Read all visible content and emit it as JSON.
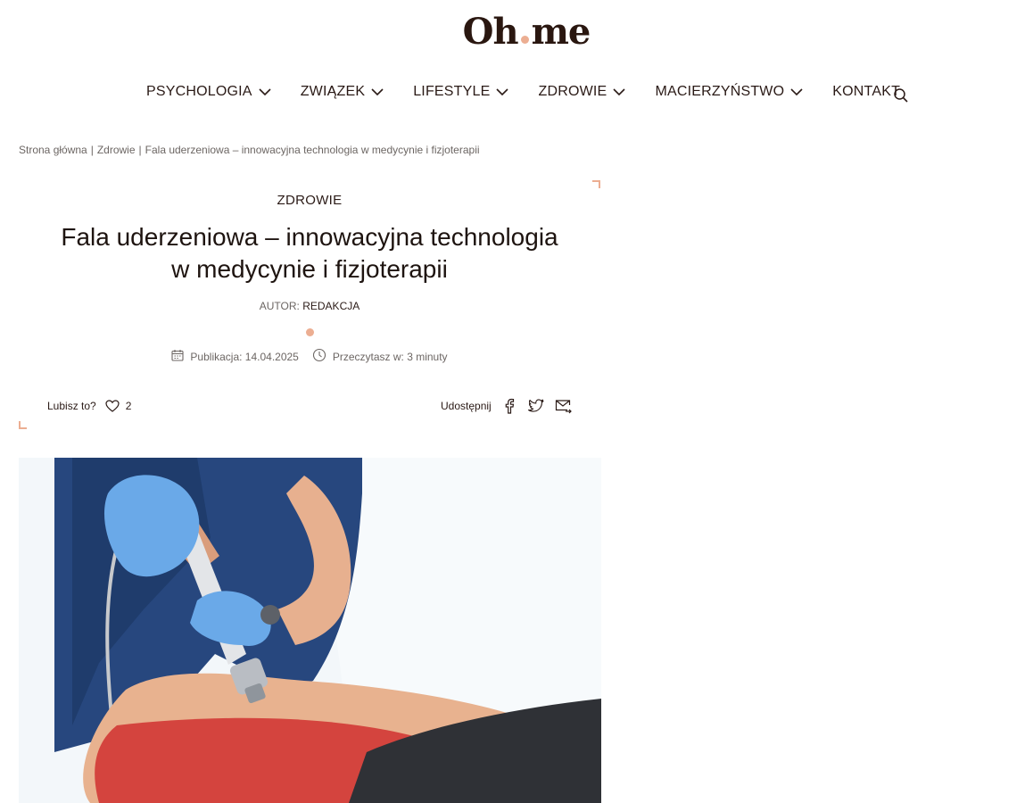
{
  "logo": {
    "part1": "Oh",
    "part2": "me"
  },
  "nav": [
    {
      "label": "PSYCHOLOGIA",
      "dropdown": true
    },
    {
      "label": "ZWIĄZEK",
      "dropdown": true
    },
    {
      "label": "LIFESTYLE",
      "dropdown": true
    },
    {
      "label": "ZDROWIE",
      "dropdown": true
    },
    {
      "label": "MACIERZYŃSTWO",
      "dropdown": true
    },
    {
      "label": "KONTAKT",
      "dropdown": false
    }
  ],
  "breadcrumb": {
    "home": "Strona główna",
    "sep": "|",
    "category": "Zdrowie",
    "current": "Fala uderzeniowa – innowacyjna technologia w medycynie i fizjoterapii"
  },
  "article": {
    "category": "ZDROWIE",
    "title_line1": "Fala uderzeniowa – innowacyjna technologia",
    "title_line2": "w medycynie i fizjoterapii",
    "author_label": "AUTOR:",
    "author_name": "REDAKCJA",
    "published": "Publikacja: 14.04.2025",
    "read_time": "Przeczytasz w: 3 minuty",
    "likes_label": "Lubisz to?",
    "likes_count": "2",
    "share_label": "Udostępnij"
  },
  "colors": {
    "accent": "#ecae92",
    "text": "#1e1410",
    "muted": "#6c6663"
  },
  "icons": [
    "chevron-down-icon",
    "search-icon",
    "calendar-icon",
    "clock-icon",
    "heart-icon",
    "facebook-icon",
    "twitter-icon",
    "email-share-icon"
  ]
}
